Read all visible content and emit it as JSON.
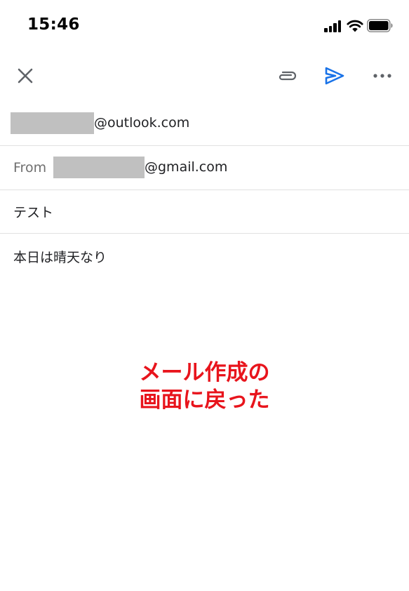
{
  "status_bar": {
    "time": "15:46"
  },
  "toolbar": {
    "icons": [
      "close-icon",
      "attachment-icon",
      "send-icon",
      "more-icon"
    ],
    "send_color": "#1a73e8"
  },
  "compose": {
    "to_suffix": "@outlook.com",
    "from_label": "From",
    "from_suffix": "@gmail.com",
    "subject": "テスト",
    "body": "本日は晴天なり"
  },
  "annotation": {
    "line1": "メール作成の",
    "line2": "画面に戻った",
    "color": "#e8141c"
  }
}
